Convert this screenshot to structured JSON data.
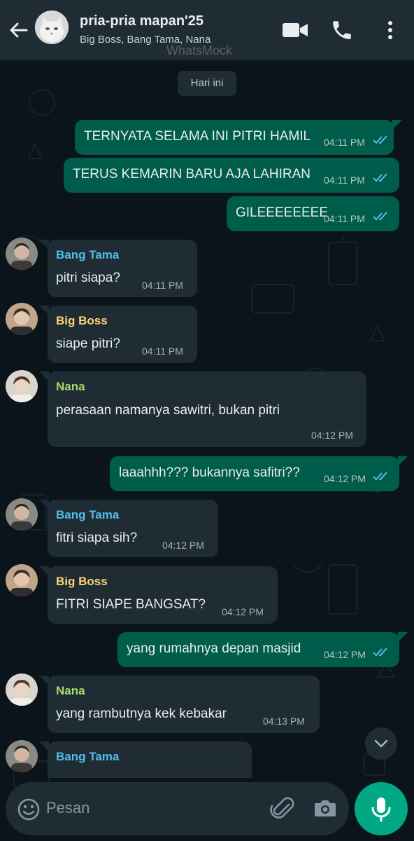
{
  "header": {
    "title": "pria-pria mapan'25",
    "subtitle": "Big Boss, Bang Tama, Nana",
    "watermark": "WhatsMock"
  },
  "chat": {
    "date_chip": "Hari ini",
    "messages": [
      {
        "direction": "out",
        "text": "TERNYATA SELAMA INI PITRI HAMIL",
        "time": "04:11 PM",
        "read": true
      },
      {
        "direction": "out",
        "text": "TERUS KEMARIN BARU AJA LAHIRAN",
        "time": "04:11 PM",
        "read": true
      },
      {
        "direction": "out",
        "text": "GILEEEEEEEE",
        "time": "04:11 PM",
        "read": true
      },
      {
        "direction": "in",
        "sender": "Bang Tama",
        "sender_color": "#53bdeb",
        "text": "pitri siapa?",
        "time": "04:11 PM"
      },
      {
        "direction": "in",
        "sender": "Big Boss",
        "sender_color": "#ffd279",
        "text": "siape pitri?",
        "time": "04:11 PM"
      },
      {
        "direction": "in",
        "sender": "Nana",
        "sender_color": "#a5d96f",
        "text": "perasaan namanya sawitri, bukan pitri",
        "time": "04:12 PM"
      },
      {
        "direction": "out",
        "text": "laaahhh??? bukannya safitri??",
        "time": "04:12 PM",
        "read": true
      },
      {
        "direction": "in",
        "sender": "Bang Tama",
        "sender_color": "#53bdeb",
        "text": "fitri siapa sih?",
        "time": "04:12 PM"
      },
      {
        "direction": "in",
        "sender": "Big Boss",
        "sender_color": "#ffd279",
        "text": "FITRI SIAPE BANGSAT?",
        "time": "04:12 PM"
      },
      {
        "direction": "out",
        "text": "yang rumahnya depan masjid",
        "time": "04:12 PM",
        "read": true
      },
      {
        "direction": "in",
        "sender": "Nana",
        "sender_color": "#a5d96f",
        "text": "yang rambutnya kek kebakar",
        "time": "04:13 PM"
      },
      {
        "direction": "in",
        "sender": "Bang Tama",
        "sender_color": "#53bdeb",
        "text": "",
        "time": ""
      }
    ]
  },
  "composer": {
    "placeholder": "Pesan"
  },
  "colors": {
    "header_bg": "#1f2c34",
    "chat_bg": "#0b141a",
    "outgoing_bubble": "#005c4b",
    "incoming_bubble": "#1f2c34",
    "accent": "#00a884",
    "read_ticks": "#53bdeb"
  },
  "icons": [
    "back-arrow-icon",
    "group-avatar",
    "video-call-icon",
    "phone-icon",
    "more-vert-icon",
    "scroll-down-icon",
    "emoji-icon",
    "attach-icon",
    "camera-icon",
    "mic-icon"
  ]
}
